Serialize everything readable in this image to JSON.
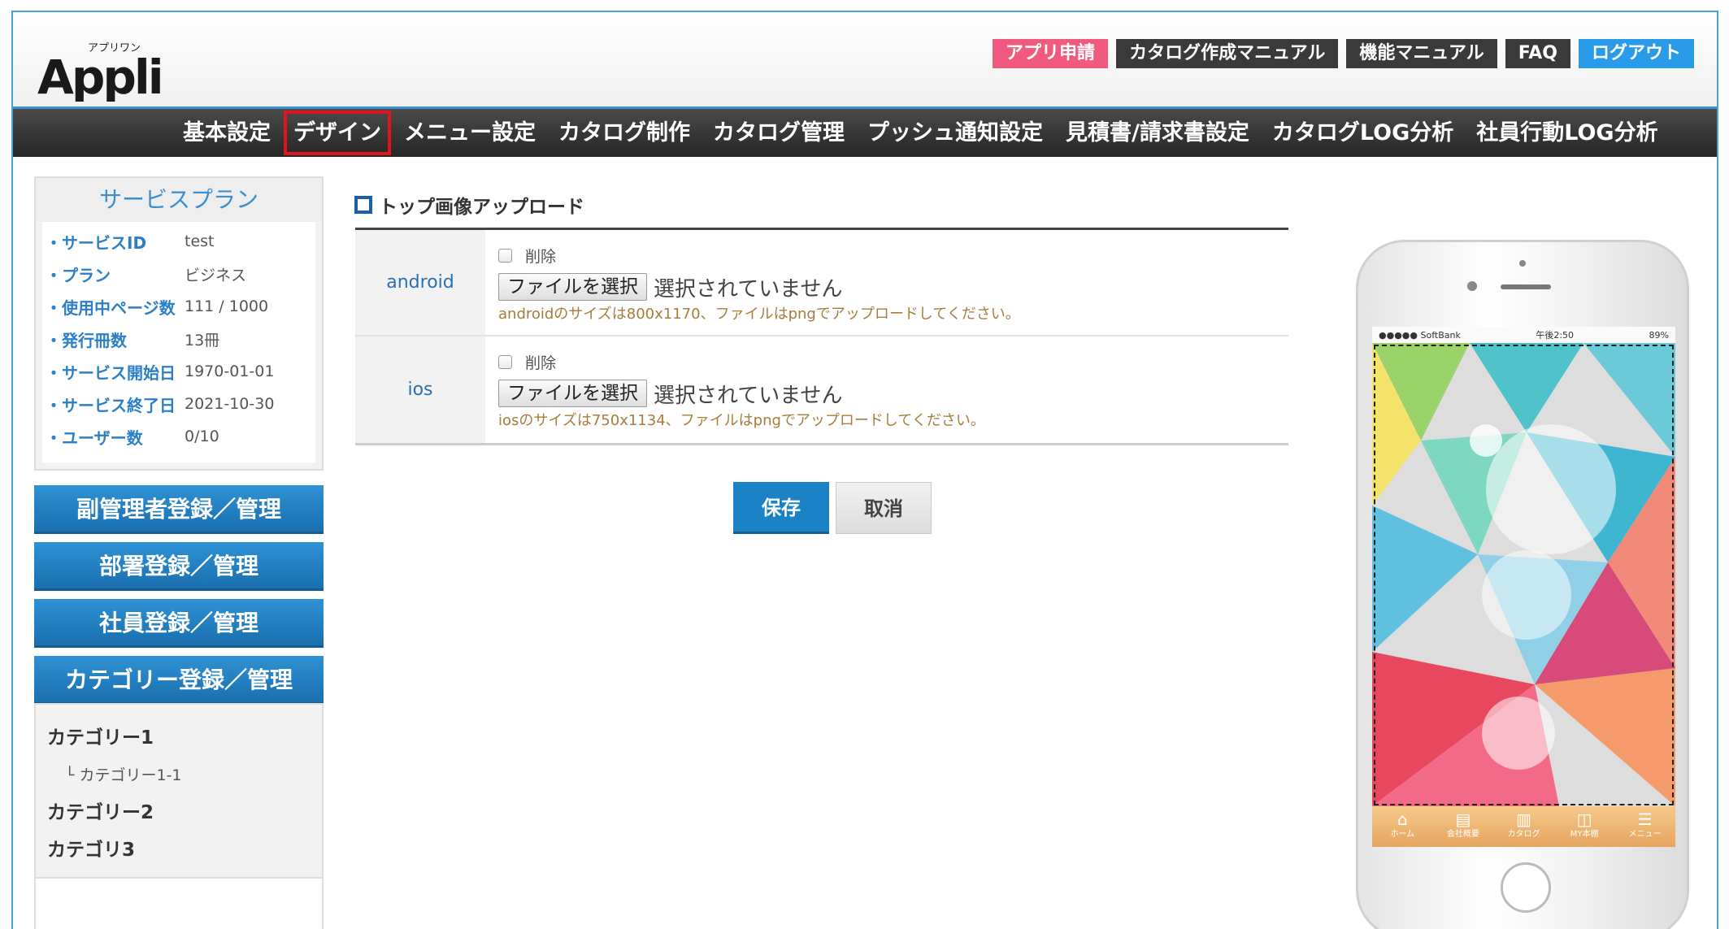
{
  "header": {
    "logo_text": "Appli",
    "logo_kana": "アプリワン",
    "top_links": [
      {
        "label": "アプリ申請",
        "style": "pink"
      },
      {
        "label": "カタログ作成マニュアル",
        "style": "dark"
      },
      {
        "label": "機能マニュアル",
        "style": "dark"
      },
      {
        "label": "FAQ",
        "style": "dark"
      },
      {
        "label": "ログアウト",
        "style": "blue"
      }
    ]
  },
  "nav": {
    "items": [
      "基本設定",
      "デザイン",
      "メニュー設定",
      "カタログ制作",
      "カタログ管理",
      "プッシュ通知設定",
      "見積書/請求書設定",
      "カタログLOG分析",
      "社員行動LOG分析"
    ],
    "active_index": 1
  },
  "sidebar": {
    "plan": {
      "title": "サービスプラン",
      "rows": [
        {
          "key": "・サービスID",
          "value": "test"
        },
        {
          "key": "・プラン",
          "value": "ビジネス"
        },
        {
          "key": "・使用中ページ数",
          "value": "111 / 1000"
        },
        {
          "key": "・発行冊数",
          "value": "13冊"
        },
        {
          "key": "・サービス開始日",
          "value": "1970-01-01"
        },
        {
          "key": "・サービス終了日",
          "value": "2021-10-30"
        },
        {
          "key": "・ユーザー数",
          "value": "0/10"
        }
      ]
    },
    "buttons": [
      "副管理者登録／管理",
      "部署登録／管理",
      "社員登録／管理",
      "カテゴリー登録／管理"
    ],
    "categories": [
      {
        "label": "カテゴリー1",
        "sub": false
      },
      {
        "label": "└ カテゴリー1-1",
        "sub": true
      },
      {
        "label": "カテゴリー2",
        "sub": false
      },
      {
        "label": "カテゴリ3",
        "sub": false
      }
    ]
  },
  "main": {
    "section_title": "トップ画像アップロード",
    "rows": [
      {
        "label": "android",
        "delete_label": "削除",
        "file_button": "ファイルを選択",
        "file_status": "選択されていません",
        "hint": "androidのサイズは800x1170、ファイルはpngでアップロードしてください。"
      },
      {
        "label": "ios",
        "delete_label": "削除",
        "file_button": "ファイルを選択",
        "file_status": "選択されていません",
        "hint": "iosのサイズは750x1134、ファイルはpngでアップロードしてください。"
      }
    ],
    "save_label": "保存",
    "cancel_label": "取消"
  },
  "phone": {
    "status_left": "●●●●● SoftBank",
    "status_time": "午後2:50",
    "status_battery": "89%",
    "tabs": [
      {
        "icon": "home-icon",
        "label": "ホーム"
      },
      {
        "icon": "document-icon",
        "label": "会社概要"
      },
      {
        "icon": "catalog-icon",
        "label": "カタログ"
      },
      {
        "icon": "book-icon",
        "label": "MY本棚"
      },
      {
        "icon": "menu-icon",
        "label": "メニュー"
      }
    ]
  },
  "colors": {
    "accent": "#1c82c6",
    "nav_active_outline": "#e0141e",
    "pink": "#f05a7e"
  }
}
